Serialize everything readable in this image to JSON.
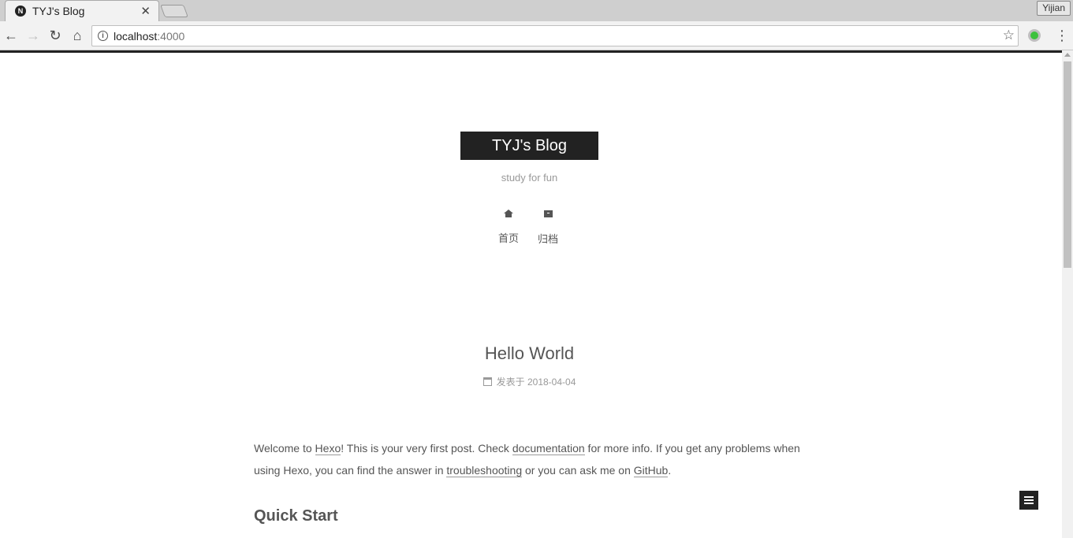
{
  "browser": {
    "tab": {
      "favicon": "N",
      "title": "TYJ's Blog",
      "close": "✕"
    },
    "profile": "Yijian",
    "url_host": "localhost",
    "url_port": ":4000",
    "info_icon": "i",
    "icons": [
      "back-icon",
      "forward-icon",
      "reload-icon",
      "home-icon",
      "info-icon",
      "star-icon",
      "extension-icon",
      "menu-icon"
    ]
  },
  "site": {
    "brand": "TYJ's Blog",
    "subtitle": "study for fun",
    "menu": [
      {
        "label": "首页",
        "icon": "home-icon"
      },
      {
        "label": "归档",
        "icon": "archive-icon"
      }
    ]
  },
  "post": {
    "title": "Hello World",
    "meta_label": "发表于",
    "date": "2018-04-04",
    "para": {
      "t1": "Welcome to ",
      "link_hexo": "Hexo",
      "t2": "! This is your very first post. Check ",
      "link_docs": "documentation",
      "t3": " for more info. If you get any problems when using Hexo, you can find the answer in ",
      "link_trouble": "troubleshooting",
      "t4": " or you can ask me on ",
      "link_github": "GitHub",
      "t5": "."
    },
    "heading": "Quick Start"
  }
}
